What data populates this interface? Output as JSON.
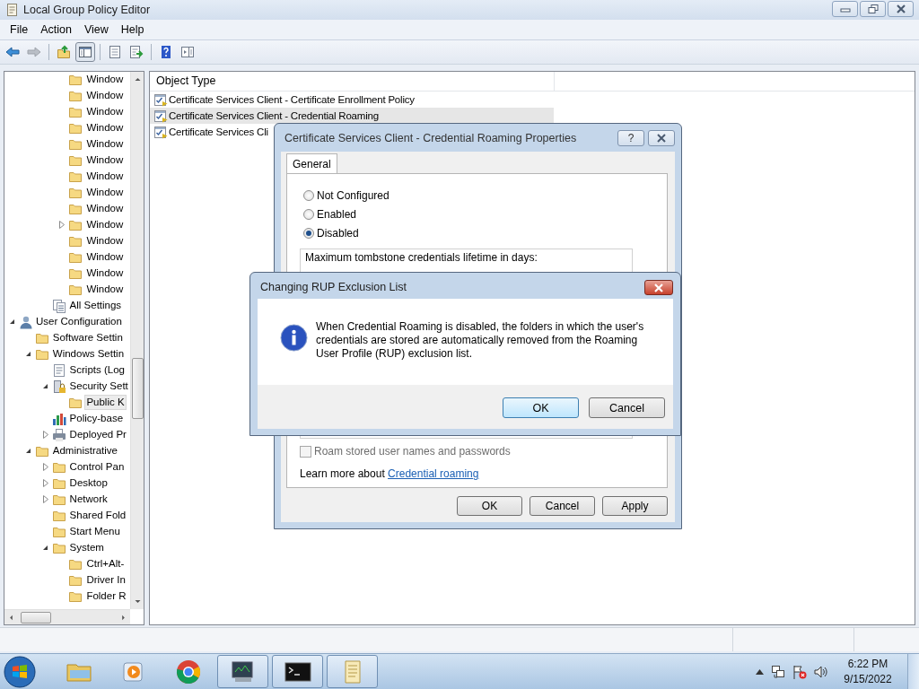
{
  "window": {
    "title": "Local Group Policy Editor"
  },
  "caption_buttons": [
    {
      "kind": "minimize"
    },
    {
      "kind": "restore"
    },
    {
      "kind": "close"
    }
  ],
  "menu": [
    "File",
    "Action",
    "View",
    "Help"
  ],
  "toolbar_groups": [
    [
      {
        "kind": "back",
        "disabled": false,
        "pressed": false
      },
      {
        "kind": "forward",
        "disabled": true,
        "pressed": false
      }
    ],
    [
      {
        "kind": "up",
        "disabled": false,
        "pressed": false
      },
      {
        "kind": "tree",
        "disabled": false,
        "pressed": true
      }
    ],
    [
      {
        "kind": "properties",
        "disabled": false,
        "pressed": false
      },
      {
        "kind": "export",
        "disabled": false,
        "pressed": false
      }
    ],
    [
      {
        "kind": "help",
        "disabled": false,
        "pressed": false
      },
      {
        "kind": "pane",
        "disabled": false,
        "pressed": false
      }
    ]
  ],
  "tree": {
    "continued": [
      {
        "label": "Window",
        "kind": "folder",
        "selected": false
      },
      {
        "label": "Window",
        "kind": "folder",
        "selected": false
      },
      {
        "label": "Window",
        "kind": "folder",
        "selected": false
      },
      {
        "label": "Window",
        "kind": "folder",
        "selected": false
      },
      {
        "label": "Window",
        "kind": "folder",
        "selected": false
      },
      {
        "label": "Window",
        "kind": "folder",
        "selected": false
      },
      {
        "label": "Window",
        "kind": "folder",
        "selected": false
      },
      {
        "label": "Window",
        "kind": "folder",
        "selected": false
      },
      {
        "label": "Window",
        "kind": "folder",
        "selected": false
      },
      {
        "label": "Window",
        "kind": "folder",
        "selected": false,
        "expanded": false
      },
      {
        "label": "Window",
        "kind": "folder",
        "selected": false
      },
      {
        "label": "Window",
        "kind": "folder",
        "selected": false
      },
      {
        "label": "Window",
        "kind": "folder",
        "selected": false
      },
      {
        "label": "Window",
        "kind": "folder",
        "selected": false
      }
    ],
    "continued_tail": [
      {
        "label": "All Settings",
        "kind": "list",
        "selected": false
      }
    ],
    "items": [
      {
        "label": "User Configuration",
        "kind": "user",
        "selected": false,
        "expanded": true,
        "children": [
          {
            "label": "Software Settin",
            "kind": "folder",
            "selected": false
          },
          {
            "label": "Windows Settin",
            "kind": "folder",
            "selected": false,
            "expanded": true,
            "children": [
              {
                "label": "Scripts (Log",
                "kind": "script",
                "selected": false
              },
              {
                "label": "Security Sett",
                "kind": "security",
                "selected": false,
                "expanded": true,
                "children": [
                  {
                    "label": "Public K",
                    "kind": "folder",
                    "selected": true
                  }
                ]
              },
              {
                "label": "Policy-base",
                "kind": "chart",
                "selected": false
              },
              {
                "label": "Deployed Pr",
                "kind": "printer",
                "selected": false,
                "expanded": false
              }
            ]
          },
          {
            "label": "Administrative",
            "kind": "folder",
            "selected": false,
            "expanded": true,
            "children": [
              {
                "label": "Control Pan",
                "kind": "folder",
                "selected": false,
                "expanded": false
              },
              {
                "label": "Desktop",
                "kind": "folder",
                "selected": false,
                "expanded": false
              },
              {
                "label": "Network",
                "kind": "folder",
                "selected": false,
                "expanded": false
              },
              {
                "label": "Shared Fold",
                "kind": "folder",
                "selected": false
              },
              {
                "label": "Start Menu",
                "kind": "folder",
                "selected": false
              },
              {
                "label": "System",
                "kind": "folder",
                "selected": false,
                "expanded": true,
                "children": [
                  {
                    "label": "Ctrl+Alt-",
                    "kind": "folder",
                    "selected": false
                  },
                  {
                    "label": "Driver In",
                    "kind": "folder",
                    "selected": false
                  },
                  {
                    "label": "Folder R",
                    "kind": "folder",
                    "selected": false
                  }
                ]
              }
            ]
          }
        ]
      }
    ]
  },
  "list": {
    "columns": [
      "Object Type"
    ],
    "rows": [
      {
        "name": "Certificate Services Client - Certificate Enrollment Policy",
        "selected": false
      },
      {
        "name": "Certificate Services Client - Credential Roaming",
        "selected": true
      },
      {
        "name": "Certificate Services Cli",
        "selected": false
      }
    ]
  },
  "properties_dialog": {
    "title": "Certificate Services Client - Credential Roaming Properties",
    "help_button": "?",
    "tabs": [
      {
        "label": "General",
        "selected": true
      }
    ],
    "options": [
      {
        "label": "Not Configured",
        "selected": false
      },
      {
        "label": "Enabled",
        "selected": false
      },
      {
        "label": "Disabled",
        "selected": true
      }
    ],
    "options_box": {
      "label": "Maximum tombstone credentials lifetime in days:"
    },
    "checkbox": {
      "label": "Roam stored user names and passwords",
      "checked": false,
      "disabled": true
    },
    "learn_more": {
      "text": "Learn more about",
      "link": "Credential roaming"
    },
    "buttons": [
      "OK",
      "Cancel",
      "Apply"
    ]
  },
  "message_box": {
    "title": "Changing RUP Exclusion List",
    "message": "When Credential Roaming is disabled, the folders in which the user's credentials are stored are automatically removed from the Roaming User Profile (RUP) exclusion list.",
    "buttons": [
      {
        "label": "OK",
        "default": true
      },
      {
        "label": "Cancel",
        "default": false
      }
    ]
  },
  "taskbar": {
    "items": [
      {
        "kind": "explorer",
        "open": false
      },
      {
        "kind": "media",
        "open": false
      },
      {
        "kind": "browser",
        "open": false
      },
      {
        "kind": "monitor",
        "open": true
      },
      {
        "kind": "terminal",
        "open": true
      },
      {
        "kind": "notepad",
        "open": true
      }
    ],
    "clock": {
      "time": "6:22 PM",
      "date": "9/15/2022"
    }
  }
}
